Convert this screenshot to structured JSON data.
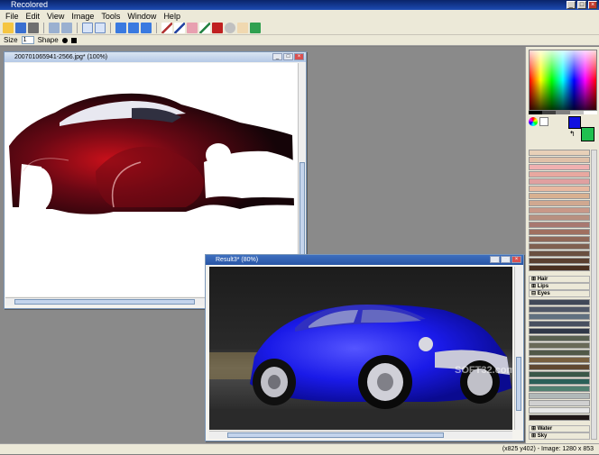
{
  "app": {
    "title": "Recolored"
  },
  "menu": [
    "File",
    "Edit",
    "View",
    "Image",
    "Tools",
    "Window",
    "Help"
  ],
  "toolbar2": {
    "size_label": "Size",
    "size_value": "1",
    "shape_label": "Shape"
  },
  "doc1": {
    "title": "200701065941-2566.jpg* (100%)"
  },
  "doc2": {
    "title": "Result3* (80%)",
    "watermark": "SOFT32.com"
  },
  "palette": {
    "primary_color": "#1010e0",
    "secondary_color": "#20c050",
    "groups": [
      "Hair",
      "Lips",
      "Eyes",
      "Water",
      "Sky"
    ]
  },
  "status": {
    "text": "(x825 y402) - Image: 1280 x 853"
  }
}
